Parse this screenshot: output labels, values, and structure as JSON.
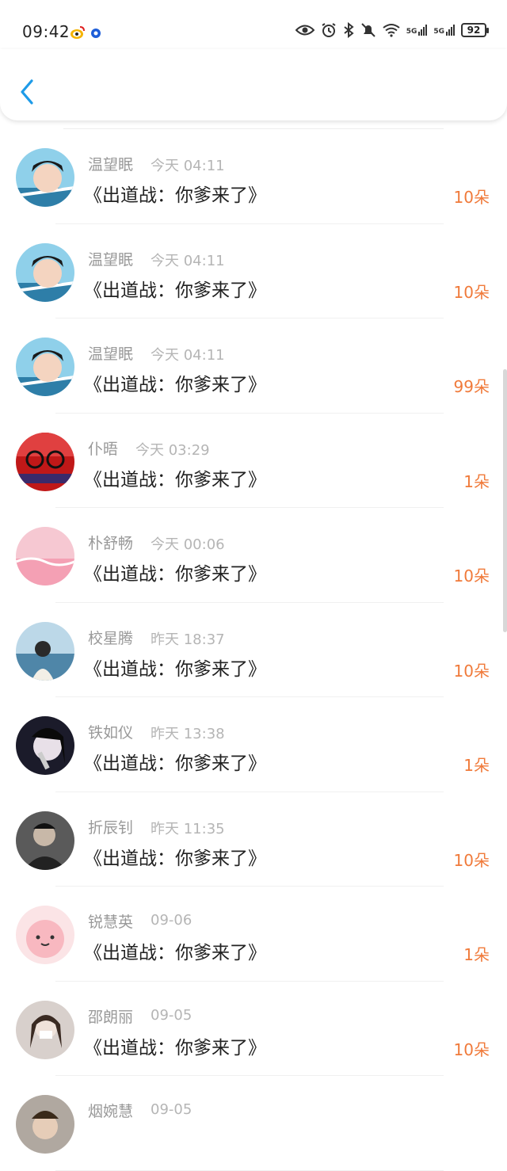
{
  "status_bar": {
    "time": "09:42",
    "battery": "92",
    "network1": "5G",
    "network2": "5G",
    "icons": [
      "weibo-icon",
      "app-dot-icon",
      "eye-icon",
      "alarm-icon",
      "bluetooth-icon",
      "mute-bell-icon",
      "wifi-icon",
      "signal-icon",
      "battery-icon"
    ]
  },
  "nav": {
    "back_icon": "chevron-left-icon"
  },
  "colors": {
    "accent": "#1e9be8",
    "amount": "#f07a3a",
    "meta": "#999999"
  },
  "gifts": [
    {
      "name": "温望眠",
      "time": "今天 04:11",
      "title": "《出道战：你爹来了》",
      "amount": "10朵",
      "avatar": "avatar-boy"
    },
    {
      "name": "温望眠",
      "time": "今天 04:11",
      "title": "《出道战：你爹来了》",
      "amount": "10朵",
      "avatar": "avatar-boy"
    },
    {
      "name": "温望眠",
      "time": "今天 04:11",
      "title": "《出道战：你爹来了》",
      "amount": "99朵",
      "avatar": "avatar-boy"
    },
    {
      "name": "仆晤",
      "time": "今天 03:29",
      "title": "《出道战：你爹来了》",
      "amount": "1朵",
      "avatar": "avatar-glasses"
    },
    {
      "name": "朴舒畅",
      "time": "今天 00:06",
      "title": "《出道战：你爹来了》",
      "amount": "10朵",
      "avatar": "avatar-pink"
    },
    {
      "name": "校星腾",
      "time": "昨天 18:37",
      "title": "《出道战：你爹来了》",
      "amount": "10朵",
      "avatar": "avatar-sea"
    },
    {
      "name": "铁如仪",
      "time": "昨天 13:38",
      "title": "《出道战：你爹来了》",
      "amount": "1朵",
      "avatar": "avatar-dark"
    },
    {
      "name": "折辰钊",
      "time": "昨天 11:35",
      "title": "《出道战：你爹来了》",
      "amount": "10朵",
      "avatar": "avatar-man"
    },
    {
      "name": "锐慧英",
      "time": "09-06",
      "title": "《出道战：你爹来了》",
      "amount": "1朵",
      "avatar": "avatar-cartoon"
    },
    {
      "name": "邵朗丽",
      "time": "09-05",
      "title": "《出道战：你爹来了》",
      "amount": "10朵",
      "avatar": "avatar-girl"
    },
    {
      "name": "烟婉慧",
      "time": "09-05",
      "title": "",
      "amount": "",
      "avatar": "avatar-boy2"
    }
  ]
}
